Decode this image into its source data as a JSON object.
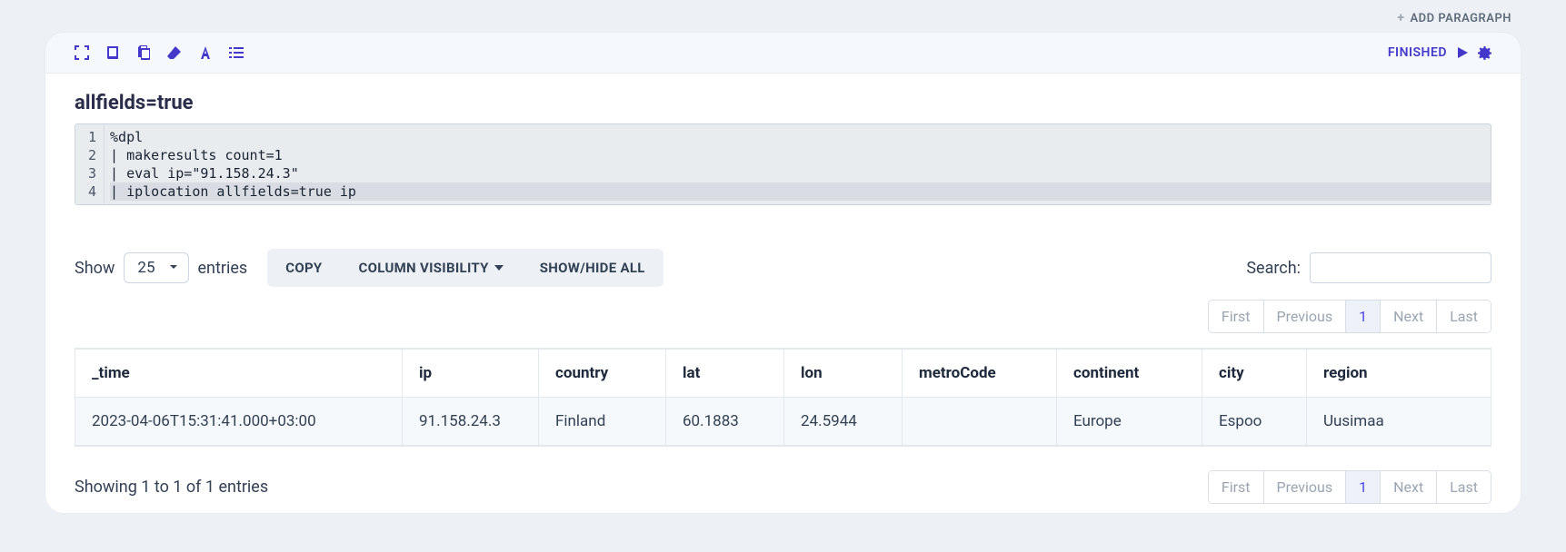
{
  "topbar": {
    "add_paragraph": "ADD PARAGRAPH"
  },
  "status": "FINISHED",
  "title": "allfields=true",
  "code": {
    "lines": [
      "%dpl",
      "| makeresults count=1",
      "| eval ip=\"91.158.24.3\"",
      "| iplocation allfields=true ip"
    ],
    "line_numbers": [
      "1",
      "2",
      "3",
      "4"
    ]
  },
  "controls": {
    "show_label": "Show",
    "entries_label": "entries",
    "page_size": "25",
    "copy": "COPY",
    "colvis": "COLUMN VISIBILITY",
    "showhide": "SHOW/HIDE ALL",
    "search_label": "Search:"
  },
  "pager": {
    "first": "First",
    "previous": "Previous",
    "page": "1",
    "next": "Next",
    "last": "Last"
  },
  "table": {
    "headers": [
      "_time",
      "ip",
      "country",
      "lat",
      "lon",
      "metroCode",
      "continent",
      "city",
      "region"
    ],
    "rows": [
      [
        "2023-04-06T15:31:41.000+03:00",
        "91.158.24.3",
        "Finland",
        "60.1883",
        "24.5944",
        "",
        "Europe",
        "Espoo",
        "Uusimaa"
      ]
    ]
  },
  "info": "Showing 1 to 1 of 1 entries"
}
